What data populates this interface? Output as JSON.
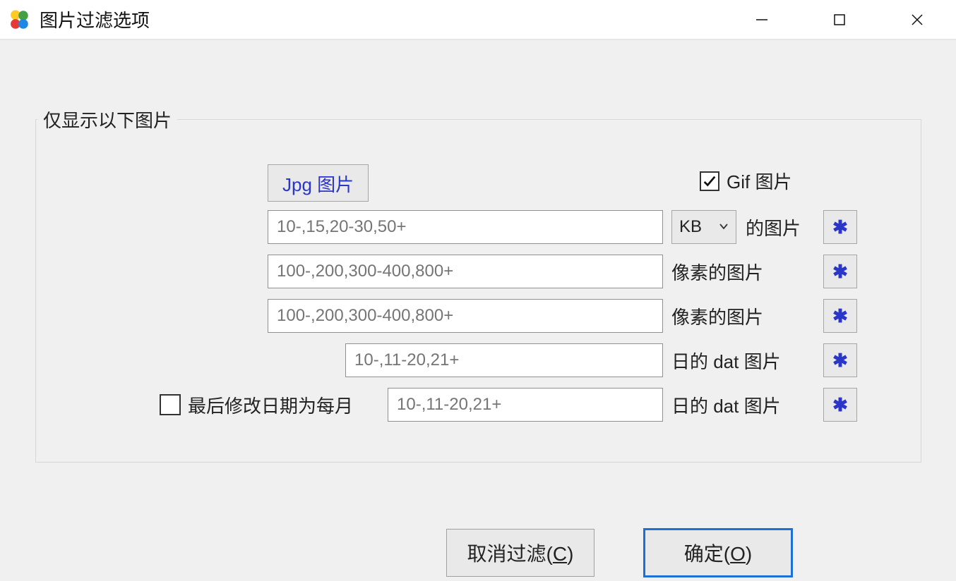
{
  "window": {
    "title": "图片过滤选项"
  },
  "group": {
    "legend": "仅显示以下图片",
    "jpg_toggle_label": "Jpg 图片",
    "gif_checkbox_label": "Gif 图片",
    "gif_checked": true
  },
  "rows": {
    "size": {
      "placeholder": "10-,15,20-30,50+",
      "unit_selected": "KB",
      "suffix": "的图片"
    },
    "width": {
      "placeholder": "100-,200,300-400,800+",
      "suffix": "像素的图片"
    },
    "height": {
      "placeholder": "100-,200,300-400,800+",
      "suffix": "像素的图片"
    },
    "day1": {
      "placeholder": "10-,11-20,21+",
      "suffix": "日的 dat 图片"
    },
    "day2": {
      "checkbox_label": "最后修改日期为每月",
      "checkbox_checked": false,
      "placeholder": "10-,11-20,21+",
      "suffix": "日的 dat 图片"
    }
  },
  "star_symbol": "✱",
  "buttons": {
    "cancel_prefix": "取消过滤(",
    "cancel_key": "C",
    "cancel_suffix": ")",
    "ok_prefix": "确定(",
    "ok_key": "O",
    "ok_suffix": ")"
  }
}
